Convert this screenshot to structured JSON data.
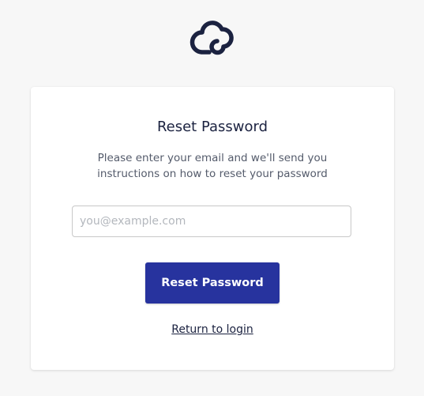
{
  "logo": {
    "icon": "cloud-icon",
    "color": "#1b2240"
  },
  "card": {
    "title": "Reset Password",
    "description": "Please enter your email and we'll send you instructions on how to reset your password",
    "email": {
      "value": "",
      "placeholder": "you@example.com"
    },
    "submit_label": "Reset Password",
    "return_link": "Return to login"
  },
  "colors": {
    "accent": "#27339e",
    "background": "#f7f7f7",
    "text": "#1b2240"
  }
}
